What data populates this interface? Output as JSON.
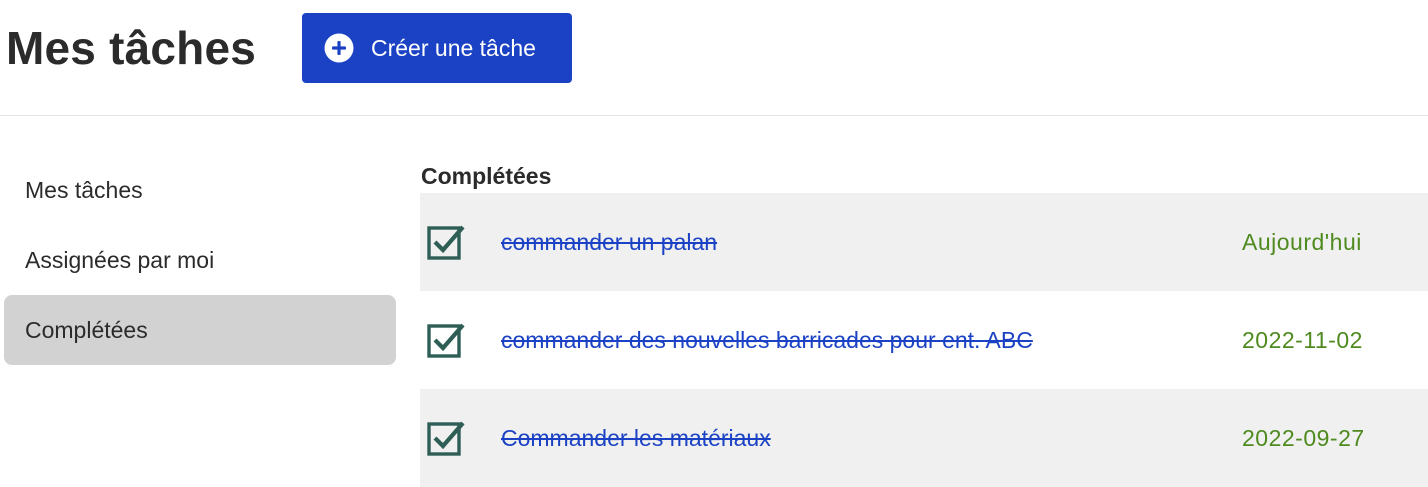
{
  "header": {
    "title": "Mes tâches",
    "create_button_label": "Créer une tâche"
  },
  "sidebar": {
    "items": [
      {
        "label": "Mes tâches",
        "active": false
      },
      {
        "label": "Assignées par moi",
        "active": false
      },
      {
        "label": "Complétées",
        "active": true
      }
    ]
  },
  "main": {
    "section_title": "Complétées",
    "tasks": [
      {
        "name": "commander un palan",
        "date": "Aujourd'hui",
        "completed": true
      },
      {
        "name": "commander des nouvelles barricades pour ent. ABC",
        "date": "2022-11-02",
        "completed": true
      },
      {
        "name": "Commander les matériaux",
        "date": "2022-09-27",
        "completed": true
      }
    ]
  },
  "colors": {
    "accent": "#1b42c4",
    "date_green": "#4f8a1f",
    "checkbox_green": "#2e5e55",
    "active_sidebar_bg": "#d2d2d2",
    "row_shade": "#f0f0f0"
  },
  "icons": {
    "create": "plus-circle-icon",
    "task_check": "checked-box-icon"
  }
}
